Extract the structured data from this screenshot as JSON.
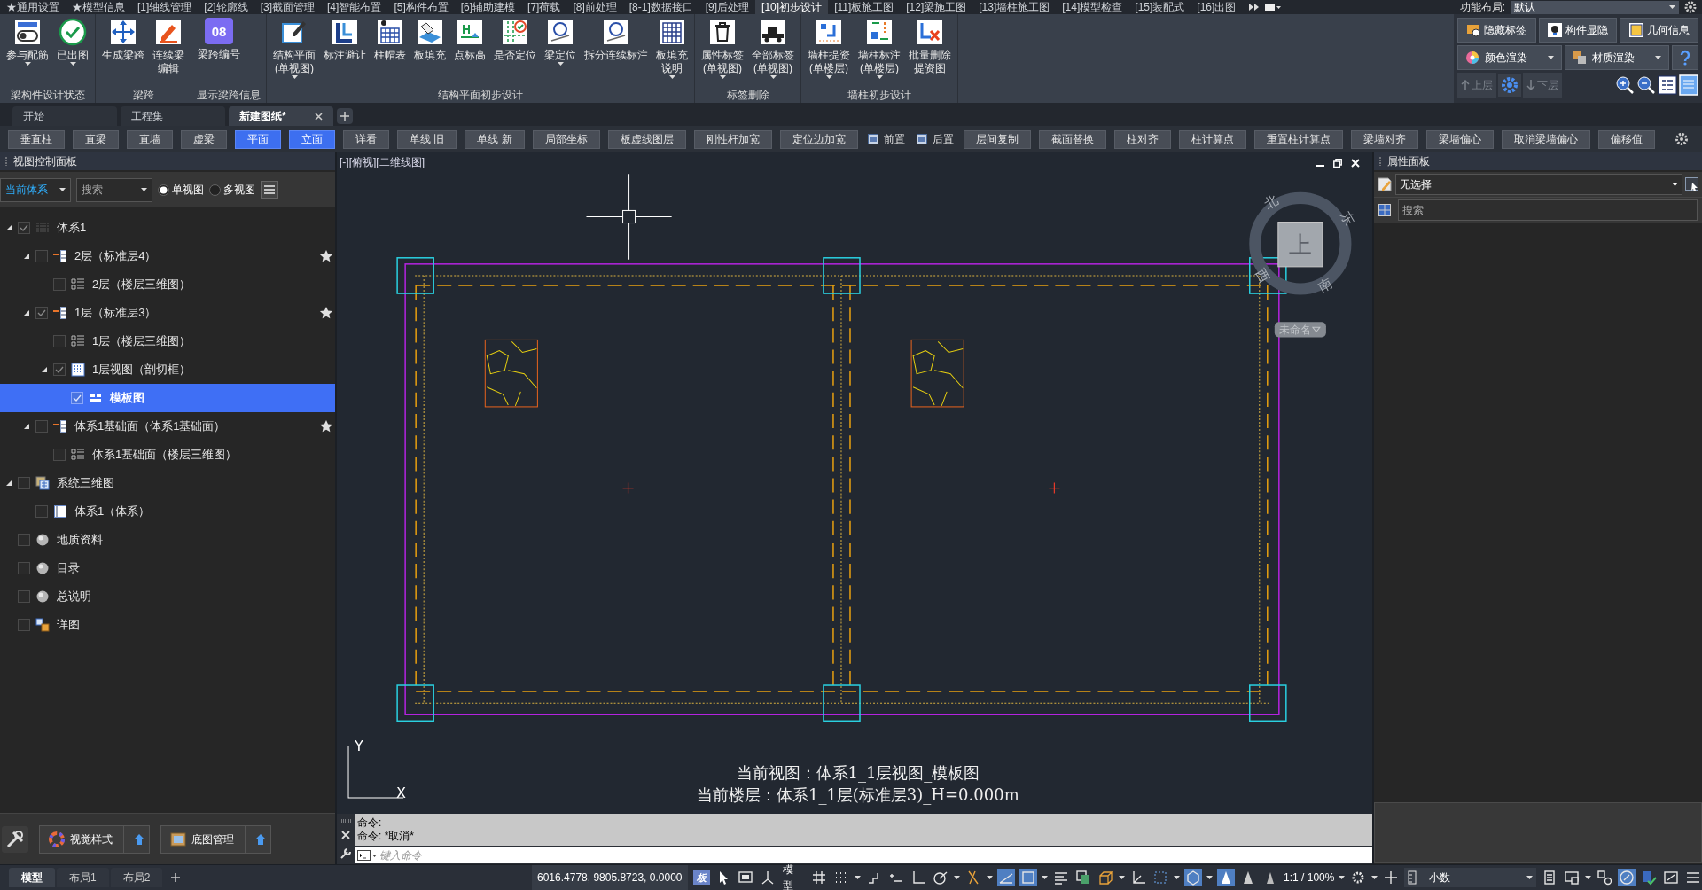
{
  "menu_tabs": [
    {
      "label": "★通用设置",
      "selected": false
    },
    {
      "label": "★模型信息",
      "selected": false
    },
    {
      "label": "[1]轴线管理",
      "selected": false
    },
    {
      "label": "[2]轮廓线",
      "selected": false
    },
    {
      "label": "[3]截面管理",
      "selected": false
    },
    {
      "label": "[4]智能布置",
      "selected": false
    },
    {
      "label": "[5]构件布置",
      "selected": false
    },
    {
      "label": "[6]辅助建模",
      "selected": false
    },
    {
      "label": "[7]荷载",
      "selected": false
    },
    {
      "label": "[8]前处理",
      "selected": false
    },
    {
      "label": "[8-1]数据接口",
      "selected": false
    },
    {
      "label": "[9]后处理",
      "selected": false
    },
    {
      "label": "[10]初步设计",
      "selected": true
    },
    {
      "label": "[11]板施工图",
      "selected": false
    },
    {
      "label": "[12]梁施工图",
      "selected": false
    },
    {
      "label": "[13]墙柱施工图",
      "selected": false
    },
    {
      "label": "[14]模型检查",
      "selected": false
    },
    {
      "label": "[15]装配式",
      "selected": false
    },
    {
      "label": "[16]出图",
      "selected": false
    }
  ],
  "layout_selector": {
    "label": "功能布局:",
    "value": "默认"
  },
  "ribbon_groups": [
    {
      "title": "梁构件设计状态",
      "items": [
        {
          "lines": [
            "参与配筋"
          ],
          "dropdown": true
        },
        {
          "lines": [
            "已出图"
          ],
          "dropdown": true
        }
      ]
    },
    {
      "title": "梁跨",
      "items": [
        {
          "lines": [
            "生成梁跨"
          ],
          "dropdown": false
        },
        {
          "lines": [
            "连续梁",
            "编辑"
          ],
          "dropdown": false
        }
      ]
    },
    {
      "title": "显示梁跨信息",
      "items": [
        {
          "lines": [
            "梁跨编号"
          ],
          "dropdown": false,
          "badge": "08"
        }
      ]
    },
    {
      "title": "结构平面初步设计",
      "items": [
        {
          "lines": [
            "结构平面",
            "(单视图)"
          ],
          "dropdown": true
        },
        {
          "lines": [
            "标注避让"
          ],
          "dropdown": false
        },
        {
          "lines": [
            "柱帽表"
          ],
          "dropdown": false
        },
        {
          "lines": [
            "板填充"
          ],
          "dropdown": false
        },
        {
          "lines": [
            "点标高"
          ],
          "dropdown": false
        },
        {
          "lines": [
            "是否定位"
          ],
          "dropdown": false
        },
        {
          "lines": [
            "梁定位"
          ],
          "dropdown": true
        },
        {
          "lines": [
            "拆分连续标注"
          ],
          "dropdown": false
        },
        {
          "lines": [
            "板填充",
            "说明"
          ],
          "dropdown": true
        }
      ]
    },
    {
      "title": "标签删除",
      "items": [
        {
          "lines": [
            "属性标签",
            "(单视图)"
          ],
          "dropdown": true
        },
        {
          "lines": [
            "全部标签",
            "(单视图)"
          ],
          "dropdown": true
        }
      ]
    },
    {
      "title": "墙柱初步设计",
      "items": [
        {
          "lines": [
            "墙柱提资",
            "(单楼层)"
          ],
          "dropdown": true
        },
        {
          "lines": [
            "墙柱标注",
            "(单楼层)"
          ],
          "dropdown": true
        },
        {
          "lines": [
            "批量删除",
            "提资图"
          ],
          "dropdown": false
        }
      ]
    }
  ],
  "quick_panel": {
    "toggles": [
      "隐藏标签",
      "构件显隐",
      "几何信息"
    ],
    "renders": [
      "颜色渲染",
      "材质渲染"
    ],
    "floor_nav": [
      {
        "label": "上层",
        "disabled": true
      },
      {
        "label": "下层",
        "disabled": true
      }
    ]
  },
  "doc_tabs": [
    {
      "label": "开始",
      "selected": false
    },
    {
      "label": "工程集",
      "selected": false
    },
    {
      "label": "新建图纸*",
      "selected": true
    }
  ],
  "toolbar": [
    {
      "label": "垂直柱",
      "kind": "button",
      "selected": false
    },
    {
      "label": "直梁",
      "kind": "button",
      "selected": false
    },
    {
      "label": "直墙",
      "kind": "button",
      "selected": false
    },
    {
      "label": "虚梁",
      "kind": "button",
      "selected": false
    },
    {
      "label": "平面",
      "kind": "button",
      "selected": true
    },
    {
      "label": "立面",
      "kind": "button",
      "selected": true
    },
    {
      "label": "详看",
      "kind": "button",
      "selected": false
    },
    {
      "label": "单线 旧",
      "kind": "button",
      "selected": false
    },
    {
      "label": "单线 新",
      "kind": "button",
      "selected": false
    },
    {
      "label": "局部坐标",
      "kind": "button",
      "selected": false
    },
    {
      "label": "板虚线图层",
      "kind": "button",
      "selected": false
    },
    {
      "label": "刚性杆加宽",
      "kind": "button",
      "selected": false
    },
    {
      "label": "定位边加宽",
      "kind": "button",
      "selected": false
    },
    {
      "label": "前置",
      "kind": "icon",
      "selected": false
    },
    {
      "label": "后置",
      "kind": "icon",
      "selected": false
    },
    {
      "label": "层间复制",
      "kind": "button",
      "selected": false
    },
    {
      "label": "截面替换",
      "kind": "button",
      "selected": false
    },
    {
      "label": "柱对齐",
      "kind": "button",
      "selected": false
    },
    {
      "label": "柱计算点",
      "kind": "button",
      "selected": false
    },
    {
      "label": "重置柱计算点",
      "kind": "button",
      "selected": false
    },
    {
      "label": "梁墙对齐",
      "kind": "button",
      "selected": false
    },
    {
      "label": "梁墙偏心",
      "kind": "button",
      "selected": false
    },
    {
      "label": "取消梁墙偏心",
      "kind": "button",
      "selected": false
    },
    {
      "label": "偏移值",
      "kind": "button",
      "selected": false
    }
  ],
  "view_panel": {
    "title": "视图控制面板",
    "scope": "当前体系",
    "search": "搜索",
    "view_modes": [
      {
        "label": "单视图",
        "selected": true
      },
      {
        "label": "多视图",
        "selected": false
      }
    ],
    "tree": [
      {
        "label": "体系1",
        "kind": "system",
        "checked": true,
        "selected": false,
        "starred": false,
        "expanded": true,
        "children": [
          {
            "label": "2层（标准层4）",
            "kind": "floor",
            "checked": false,
            "selected": false,
            "starred": true,
            "expanded": true,
            "children": [
              {
                "label": "2层（楼层三维图）",
                "kind": "floor-3d",
                "checked": false,
                "selected": false,
                "starred": false
              }
            ]
          },
          {
            "label": "1层（标准层3）",
            "kind": "floor",
            "checked": true,
            "selected": false,
            "starred": true,
            "expanded": true,
            "children": [
              {
                "label": "1层（楼层三维图）",
                "kind": "floor-3d",
                "checked": false,
                "selected": false,
                "starred": false
              },
              {
                "label": "1层视图（剖切框）",
                "kind": "section-view",
                "checked": true,
                "selected": false,
                "starred": false,
                "expanded": true,
                "children": [
                  {
                    "label": "模板图",
                    "kind": "sheet",
                    "checked": true,
                    "selected": true,
                    "starred": false
                  }
                ]
              }
            ]
          },
          {
            "label": "体系1基础面（体系1基础面）",
            "kind": "floor",
            "checked": false,
            "selected": false,
            "starred": true,
            "expanded": true,
            "children": [
              {
                "label": "体系1基础面（楼层三维图）",
                "kind": "floor-3d",
                "checked": false,
                "selected": false,
                "starred": false
              }
            ]
          }
        ]
      },
      {
        "label": "系统三维图",
        "kind": "system-3d",
        "checked": false,
        "selected": false,
        "starred": false,
        "expanded": true,
        "children": [
          {
            "label": "体系1（体系）",
            "kind": "system-item",
            "checked": false,
            "selected": false,
            "starred": false
          }
        ]
      },
      {
        "label": "地质资料",
        "kind": "topic",
        "checked": false,
        "selected": false,
        "starred": false
      },
      {
        "label": "目录",
        "kind": "topic",
        "checked": false,
        "selected": false,
        "starred": false
      },
      {
        "label": "总说明",
        "kind": "topic",
        "checked": false,
        "selected": false,
        "starred": false
      },
      {
        "label": "详图",
        "kind": "detail",
        "checked": false,
        "selected": false,
        "starred": false
      }
    ]
  },
  "bottom_tools": [
    "视觉样式",
    "底图管理"
  ],
  "canvas": {
    "header": "[-][俯视][二维线图]",
    "compass": {
      "north": "北",
      "east": "东",
      "south": "南",
      "west": "西",
      "top": "上",
      "view_name": "未命名"
    },
    "axes": {
      "x": "X",
      "y": "Y"
    },
    "captions": [
      "当前视图：体系1_1层视图_模板图",
      "当前楼层：体系1_1层(标准层3)_H=0.000m"
    ]
  },
  "command": {
    "lines": [
      "命令:",
      "命令: *取消*"
    ],
    "placeholder": "键入命令"
  },
  "property_panel": {
    "title": "属性面板",
    "selection": "无选择",
    "placeholder": "搜索"
  },
  "layout_tabs": [
    {
      "label": "模型",
      "selected": true
    },
    {
      "label": "布局1",
      "selected": false
    },
    {
      "label": "布局2",
      "selected": false
    }
  ],
  "status": {
    "coordinates": "6016.4778, 9805.8723, 0.0000",
    "badge": "板",
    "space": "模型",
    "scale": "1:1 / 100%",
    "units": "小数"
  }
}
